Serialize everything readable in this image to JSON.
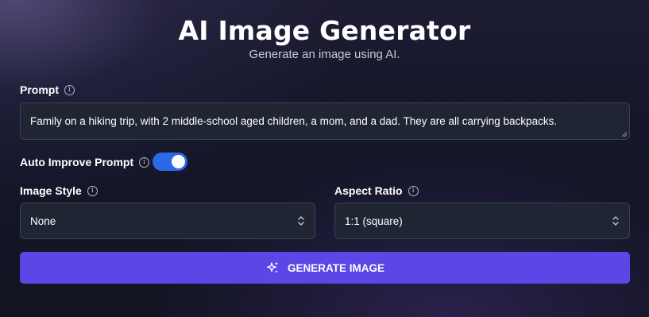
{
  "header": {
    "title": "AI Image Generator",
    "subtitle": "Generate an image using AI."
  },
  "prompt": {
    "label": "Prompt",
    "value": "Family on a hiking trip, with 2 middle-school aged children, a mom, and a dad. They are all carrying backpacks."
  },
  "auto_improve": {
    "label": "Auto Improve Prompt",
    "enabled": true
  },
  "image_style": {
    "label": "Image Style",
    "selected": "None"
  },
  "aspect_ratio": {
    "label": "Aspect Ratio",
    "selected": "1:1 (square)"
  },
  "generate": {
    "label": "GENERATE IMAGE"
  },
  "icons": {
    "info": "info-icon",
    "sparkle": "sparkles-icon",
    "select": "chevron-up-down-icon"
  },
  "colors": {
    "accent_button": "#5b47e6",
    "toggle_on": "#2a6ae8",
    "field_background": "#1f2533"
  }
}
